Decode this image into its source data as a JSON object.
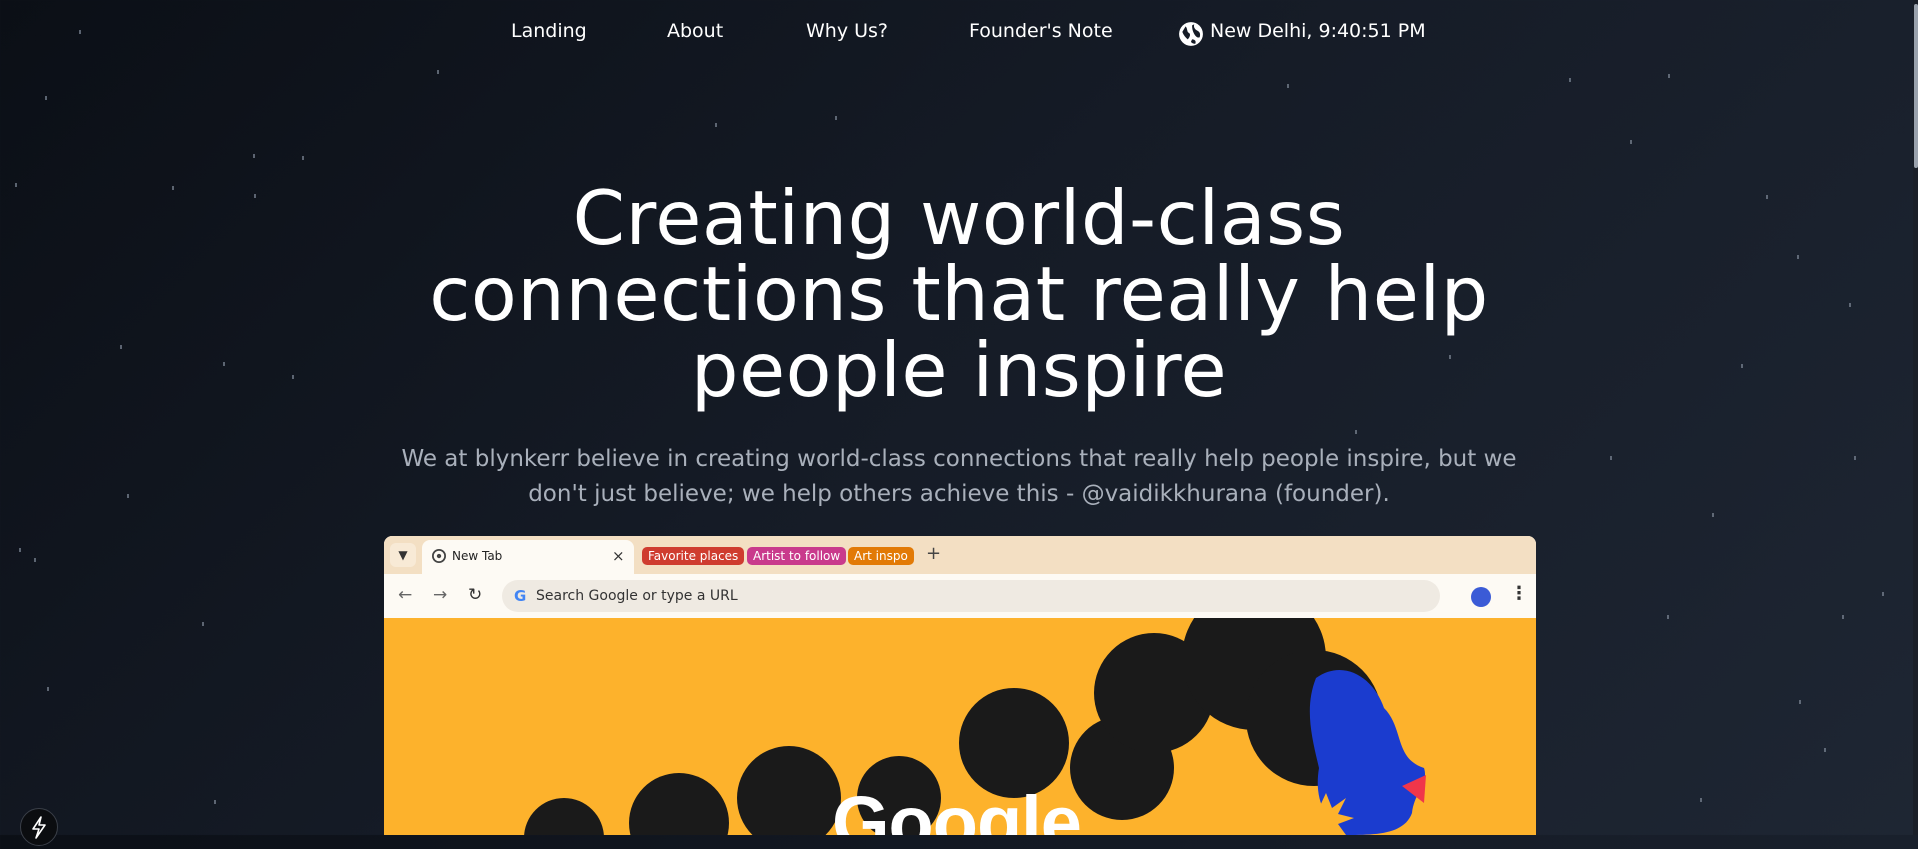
{
  "nav": {
    "links": [
      "Landing",
      "About",
      "Why Us?",
      "Founder's Note"
    ],
    "location_time": "New Delhi, 9:40:51 PM",
    "location_icon": "globe-icon"
  },
  "hero": {
    "title_lines": [
      "Creating world-class",
      "connections that really help",
      "people inspire"
    ],
    "subtitle_line1": "We at blynkerr believe in creating world-class connections that really help people inspire, but we",
    "subtitle_line2": "don't just believe; we help others achieve this - @vaidikkhurana (founder)."
  },
  "browser": {
    "active_tab_label": "New Tab",
    "tab_groups": [
      {
        "label": "Favorite places",
        "color": "#cf3c2f"
      },
      {
        "label": "Artist to follow",
        "color": "#c93a8c"
      },
      {
        "label": "Art inspo",
        "color": "#e27a06"
      }
    ],
    "omnibox_placeholder": "Search Google or type a URL",
    "doodle_word": "Google",
    "icons": [
      "chevron-down-icon",
      "chrome-icon",
      "close-icon",
      "plus-icon",
      "back-icon",
      "forward-icon",
      "reload-icon",
      "google-g-icon",
      "bookmark-star-icon",
      "profile-avatar",
      "kebab-menu-icon"
    ]
  },
  "colors": {
    "background": "#141a24",
    "ntp_yellow": "#fdb22c",
    "doodle_black": "#1a1a1a",
    "doodle_blue": "#1b3ccf",
    "doodle_red": "#f0364a"
  },
  "misc": {
    "bolt_icon": "lightning-bolt-icon"
  }
}
